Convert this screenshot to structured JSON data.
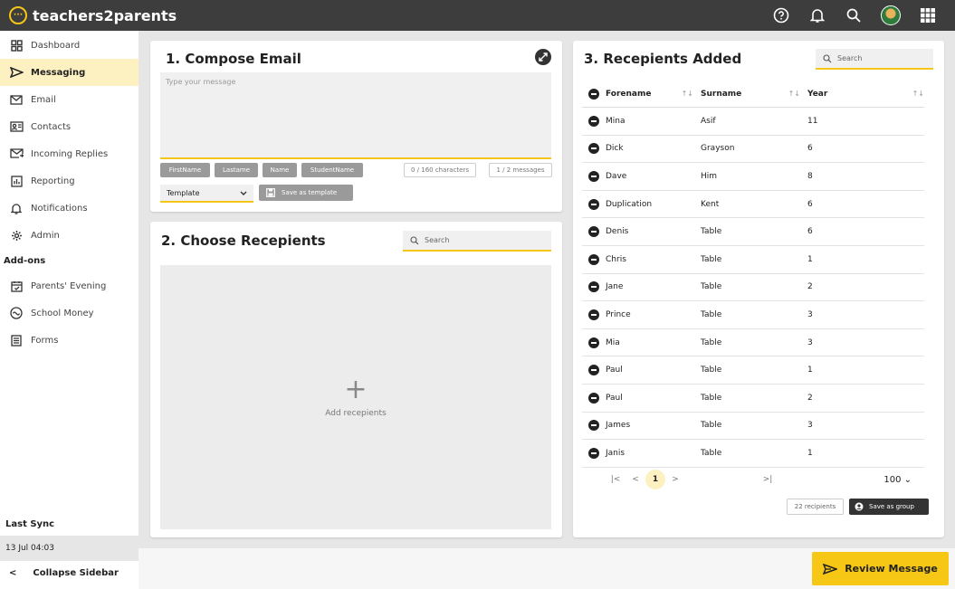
{
  "app": {
    "name": "teachers2parents",
    "logo_glyph": "···"
  },
  "colors": {
    "accent": "#f5c518",
    "topbar": "#3d3d3d",
    "active_bg": "#fdf1c2"
  },
  "topbar": {
    "icons": [
      "help-icon",
      "bell-icon",
      "search-icon",
      "avatar",
      "apps-grid-icon"
    ]
  },
  "sidebar": {
    "items": [
      {
        "label": "Dashboard",
        "icon": "dashboard-icon"
      },
      {
        "label": "Messaging",
        "icon": "send-icon"
      },
      {
        "label": "Email",
        "icon": "mail-icon"
      },
      {
        "label": "Contacts",
        "icon": "contacts-icon"
      },
      {
        "label": "Incoming Replies",
        "icon": "incoming-icon"
      },
      {
        "label": "Reporting",
        "icon": "reporting-icon"
      },
      {
        "label": "Notifications",
        "icon": "bell-icon"
      },
      {
        "label": "Admin",
        "icon": "gear-icon"
      }
    ],
    "addons_label": "Add-ons",
    "addons": [
      {
        "label": "Parents' Evening",
        "icon": "calendar-icon"
      },
      {
        "label": "School Money",
        "icon": "money-icon"
      },
      {
        "label": "Forms",
        "icon": "forms-icon"
      }
    ],
    "last_sync_label": "Last Sync",
    "last_sync_value": "13 Jul 04:03",
    "collapse_glyph": "<",
    "collapse_label": "Collapse Sidebar"
  },
  "compose": {
    "title": "1. Compose Email",
    "placeholder": "Type your message",
    "fields": [
      "FirstName",
      "Lastame",
      "Name",
      "StudentName"
    ],
    "char_count": "0 / 160 characters",
    "msg_count": "1 / 2 messages",
    "template_label": "Template",
    "save_template_label": "Save as template"
  },
  "choose": {
    "title": "2. Choose Recepients",
    "search_placeholder": "Search",
    "plus_glyph": "+",
    "add_label": "Add recepients"
  },
  "recipients": {
    "title": "3. Recepients Added",
    "search_placeholder": "Search",
    "headers": {
      "forename": "Forename",
      "surname": "Surname",
      "year": "Year"
    },
    "sort_glyph": "↑↓",
    "rows": [
      {
        "forename": "Mina",
        "surname": "Asif",
        "year": "11"
      },
      {
        "forename": "Dick",
        "surname": "Grayson",
        "year": "6"
      },
      {
        "forename": "Dave",
        "surname": "Him",
        "year": "8"
      },
      {
        "forename": "Duplication",
        "surname": "Kent",
        "year": "6"
      },
      {
        "forename": "Denis",
        "surname": "Table",
        "year": "6"
      },
      {
        "forename": "Chris",
        "surname": "Table",
        "year": "1"
      },
      {
        "forename": "Jane",
        "surname": "Table",
        "year": "2"
      },
      {
        "forename": "Prince",
        "surname": "Table",
        "year": "3"
      },
      {
        "forename": "Mia",
        "surname": "Table",
        "year": "3"
      },
      {
        "forename": "Paul",
        "surname": "Table",
        "year": "1"
      },
      {
        "forename": "Paul",
        "surname": "Table",
        "year": "2"
      },
      {
        "forename": "James",
        "surname": "Table",
        "year": "3"
      },
      {
        "forename": "Janis",
        "surname": "Table",
        "year": "1"
      }
    ],
    "pager": {
      "first": "|<",
      "prev": "<",
      "page": "1",
      "next": ">",
      "last": ">|",
      "page_size": "100 ⌄"
    },
    "count_label": "22 recipients",
    "save_group_label": "Save as group"
  },
  "footer": {
    "review_label": "Review Message"
  }
}
